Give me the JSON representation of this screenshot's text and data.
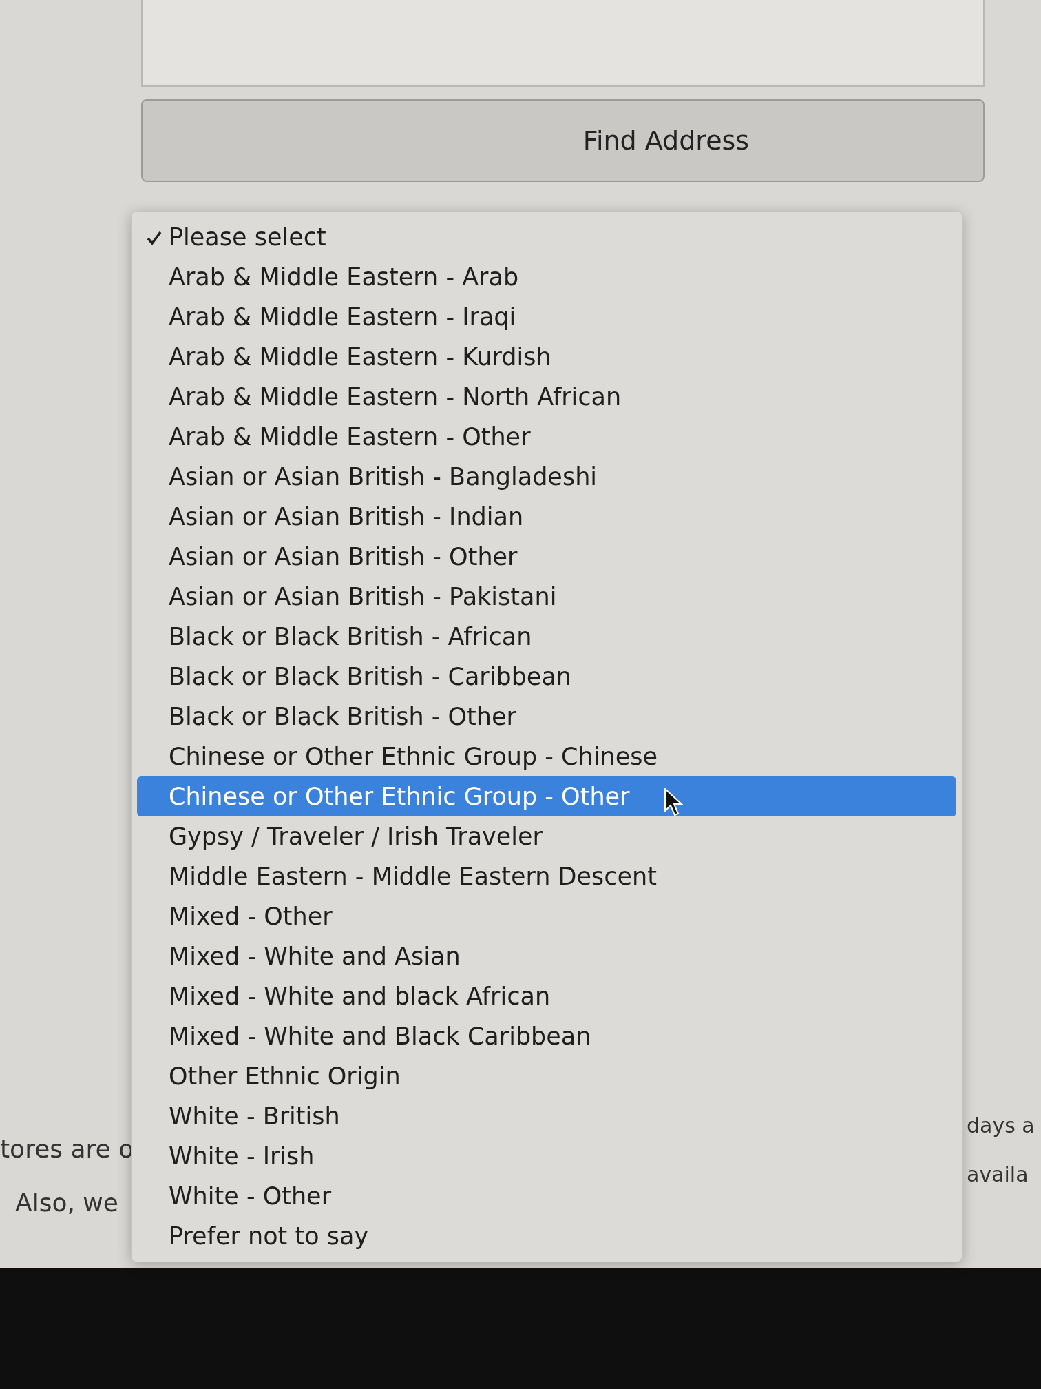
{
  "address_field": {
    "kind": "input"
  },
  "find_address_button": {
    "label": "Find Address"
  },
  "background_text": {
    "left": [
      "tores are o",
      "Also, we"
    ],
    "right": [
      "days a",
      "availa"
    ]
  },
  "dropdown": {
    "options": [
      {
        "label": "Please select",
        "checked": true,
        "selected": false
      },
      {
        "label": "Arab & Middle Eastern - Arab",
        "checked": false,
        "selected": false
      },
      {
        "label": "Arab & Middle Eastern - Iraqi",
        "checked": false,
        "selected": false
      },
      {
        "label": "Arab & Middle Eastern - Kurdish",
        "checked": false,
        "selected": false
      },
      {
        "label": "Arab & Middle Eastern - North African",
        "checked": false,
        "selected": false
      },
      {
        "label": "Arab & Middle Eastern - Other",
        "checked": false,
        "selected": false
      },
      {
        "label": "Asian or Asian British - Bangladeshi",
        "checked": false,
        "selected": false
      },
      {
        "label": "Asian or Asian British - Indian",
        "checked": false,
        "selected": false
      },
      {
        "label": "Asian or Asian British - Other",
        "checked": false,
        "selected": false
      },
      {
        "label": "Asian or Asian British - Pakistani",
        "checked": false,
        "selected": false
      },
      {
        "label": "Black or Black British - African",
        "checked": false,
        "selected": false
      },
      {
        "label": "Black or Black British - Caribbean",
        "checked": false,
        "selected": false
      },
      {
        "label": "Black or Black British - Other",
        "checked": false,
        "selected": false
      },
      {
        "label": "Chinese or Other Ethnic Group - Chinese",
        "checked": false,
        "selected": false
      },
      {
        "label": "Chinese or Other Ethnic Group - Other",
        "checked": false,
        "selected": true
      },
      {
        "label": "Gypsy / Traveler / Irish Traveler",
        "checked": false,
        "selected": false
      },
      {
        "label": "Middle Eastern - Middle Eastern Descent",
        "checked": false,
        "selected": false
      },
      {
        "label": "Mixed - Other",
        "checked": false,
        "selected": false
      },
      {
        "label": "Mixed - White and Asian",
        "checked": false,
        "selected": false
      },
      {
        "label": "Mixed - White and black African",
        "checked": false,
        "selected": false
      },
      {
        "label": "Mixed - White and Black Caribbean",
        "checked": false,
        "selected": false
      },
      {
        "label": "Other Ethnic Origin",
        "checked": false,
        "selected": false
      },
      {
        "label": "White - British",
        "checked": false,
        "selected": false
      },
      {
        "label": "White - Irish",
        "checked": false,
        "selected": false
      },
      {
        "label": "White - Other",
        "checked": false,
        "selected": false
      },
      {
        "label": "Prefer not to say",
        "checked": false,
        "selected": false
      }
    ]
  }
}
